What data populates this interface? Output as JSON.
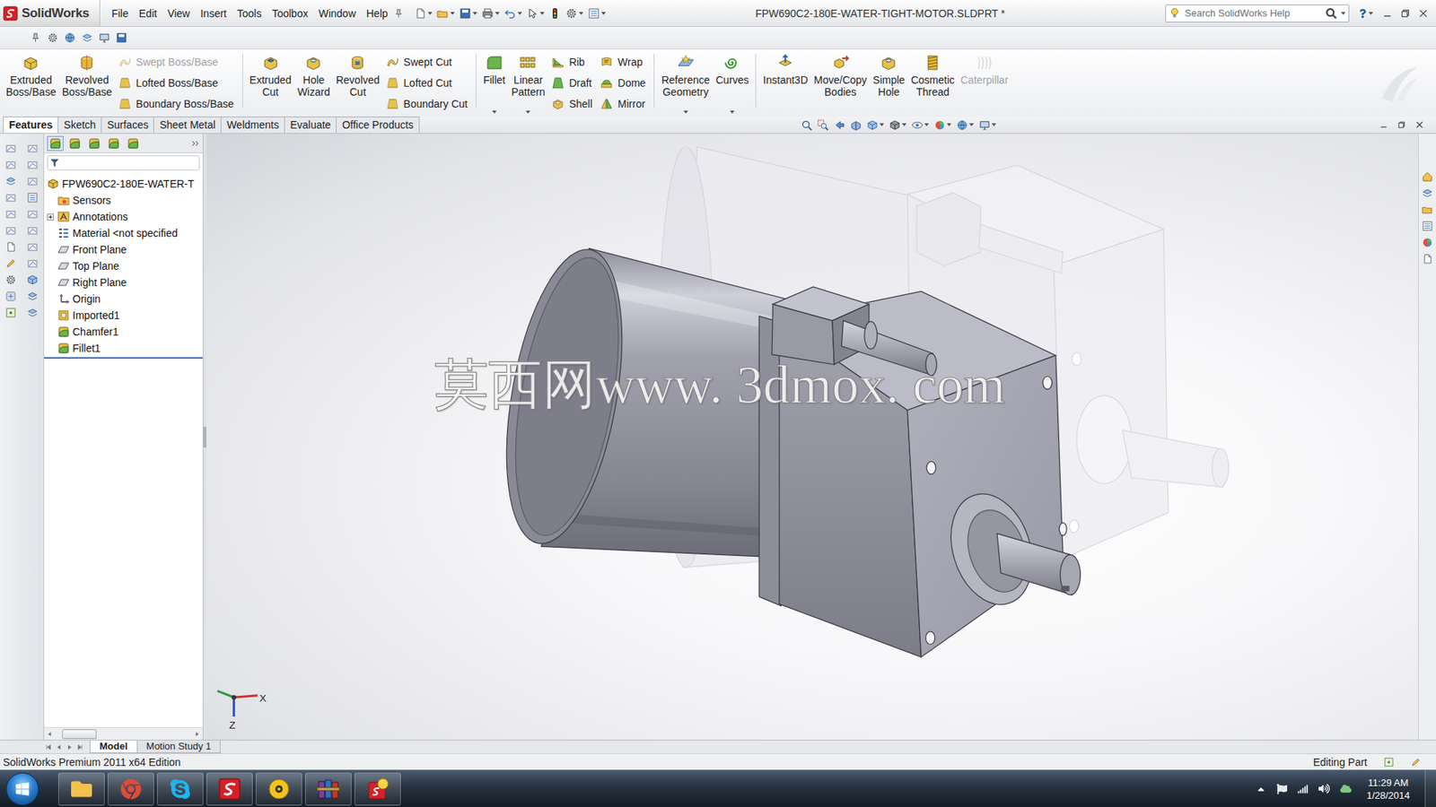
{
  "app": {
    "name": "SolidWorks"
  },
  "menu": [
    "File",
    "Edit",
    "View",
    "Insert",
    "Tools",
    "Toolbox",
    "Window",
    "Help"
  ],
  "window": {
    "title": "FPW690C2-180E-WATER-TIGHT-MOTOR.SLDPRT *"
  },
  "search": {
    "placeholder": "Search SolidWorks Help"
  },
  "ribbon": [
    {
      "kind": "large",
      "label": "Extruded Boss/Base",
      "disabled": false,
      "dropdown": false
    },
    {
      "kind": "large",
      "label": "Revolved Boss/Base",
      "disabled": false,
      "dropdown": false
    },
    {
      "kind": "stack",
      "items": [
        {
          "label": "Swept Boss/Base",
          "disabled": true
        },
        {
          "label": "Lofted Boss/Base",
          "disabled": false
        },
        {
          "label": "Boundary Boss/Base",
          "disabled": false
        }
      ]
    },
    {
      "kind": "separator"
    },
    {
      "kind": "large",
      "label": "Extruded Cut",
      "disabled": false,
      "dropdown": false
    },
    {
      "kind": "large",
      "label": "Hole Wizard",
      "disabled": false,
      "dropdown": false
    },
    {
      "kind": "large",
      "label": "Revolved Cut",
      "disabled": false,
      "dropdown": false
    },
    {
      "kind": "stack",
      "items": [
        {
          "label": "Swept Cut",
          "disabled": false
        },
        {
          "label": "Lofted Cut",
          "disabled": false
        },
        {
          "label": "Boundary Cut",
          "disabled": false
        }
      ]
    },
    {
      "kind": "separator"
    },
    {
      "kind": "large",
      "label": "Fillet",
      "disabled": false,
      "dropdown": true
    },
    {
      "kind": "large",
      "label": "Linear Pattern",
      "disabled": false,
      "dropdown": true
    },
    {
      "kind": "stack",
      "items": [
        {
          "label": "Rib",
          "disabled": false
        },
        {
          "label": "Draft",
          "disabled": false
        },
        {
          "label": "Shell",
          "disabled": false
        }
      ]
    },
    {
      "kind": "stack",
      "items": [
        {
          "label": "Wrap",
          "disabled": false
        },
        {
          "label": "Dome",
          "disabled": false
        },
        {
          "label": "Mirror",
          "disabled": false
        }
      ]
    },
    {
      "kind": "separator"
    },
    {
      "kind": "large",
      "label": "Reference Geometry",
      "disabled": false,
      "dropdown": true
    },
    {
      "kind": "large",
      "label": "Curves",
      "disabled": false,
      "dropdown": true
    },
    {
      "kind": "separator"
    },
    {
      "kind": "large",
      "label": "Instant3D",
      "disabled": false,
      "dropdown": false
    },
    {
      "kind": "large",
      "label": "Move/Copy Bodies",
      "disabled": false,
      "dropdown": false
    },
    {
      "kind": "large",
      "label": "Simple Hole",
      "disabled": false,
      "dropdown": false
    },
    {
      "kind": "large",
      "label": "Cosmetic Thread",
      "disabled": false,
      "dropdown": false
    },
    {
      "kind": "large",
      "label": "Caterpillar",
      "disabled": true,
      "dropdown": false
    }
  ],
  "command_tabs": [
    {
      "label": "Features",
      "selected": true
    },
    {
      "label": "Sketch",
      "selected": false
    },
    {
      "label": "Surfaces",
      "selected": false
    },
    {
      "label": "Sheet Metal",
      "selected": false
    },
    {
      "label": "Weldments",
      "selected": false
    },
    {
      "label": "Evaluate",
      "selected": false
    },
    {
      "label": "Office Products",
      "selected": false
    }
  ],
  "panel_tabs": [
    {
      "kind": "feature-manager",
      "selected": true
    },
    {
      "kind": "property-manager",
      "selected": false
    },
    {
      "kind": "configuration-manager",
      "selected": false
    },
    {
      "kind": "dimxpert",
      "selected": false
    },
    {
      "kind": "display-manager",
      "selected": false
    }
  ],
  "feature_tree": {
    "root": {
      "label": "FPW690C2-180E-WATER-T",
      "kind": "part"
    },
    "items": [
      {
        "label": "Sensors",
        "kind": "sensors",
        "expandable": false,
        "expanded": false
      },
      {
        "label": "Annotations",
        "kind": "annotations",
        "expandable": true,
        "expanded": false
      },
      {
        "label": "Material <not specified",
        "kind": "material",
        "expandable": false,
        "expanded": false
      },
      {
        "label": "Front Plane",
        "kind": "plane",
        "expandable": false,
        "expanded": false
      },
      {
        "label": "Top Plane",
        "kind": "plane",
        "expandable": false,
        "expanded": false
      },
      {
        "label": "Right Plane",
        "kind": "plane",
        "expandable": false,
        "expanded": false
      },
      {
        "label": "Origin",
        "kind": "origin",
        "expandable": false,
        "expanded": false
      },
      {
        "label": "Imported1",
        "kind": "imported",
        "expandable": false,
        "expanded": false
      },
      {
        "label": "Chamfer1",
        "kind": "feature",
        "expandable": false,
        "expanded": false
      },
      {
        "label": "Fillet1",
        "kind": "feature",
        "expandable": false,
        "expanded": false
      }
    ]
  },
  "viewport": {
    "watermark": "莫西网www. 3dmox. com",
    "triad": {
      "x_label": "X",
      "z_label": "Z"
    }
  },
  "bottom_tabs": [
    {
      "label": "Model",
      "selected": true
    },
    {
      "label": "Motion Study 1",
      "selected": false
    }
  ],
  "status_bar": {
    "edition": "SolidWorks Premium 2011 x64 Edition",
    "mode": "Editing Part"
  },
  "taskbar": {
    "apps": [
      {
        "kind": "explorer"
      },
      {
        "kind": "chrome"
      },
      {
        "kind": "skype"
      },
      {
        "kind": "solidworks"
      },
      {
        "kind": "media-player"
      },
      {
        "kind": "winrar"
      },
      {
        "kind": "solidworks-help"
      }
    ],
    "time": "11:29 AM",
    "date": "1/28/2014"
  }
}
